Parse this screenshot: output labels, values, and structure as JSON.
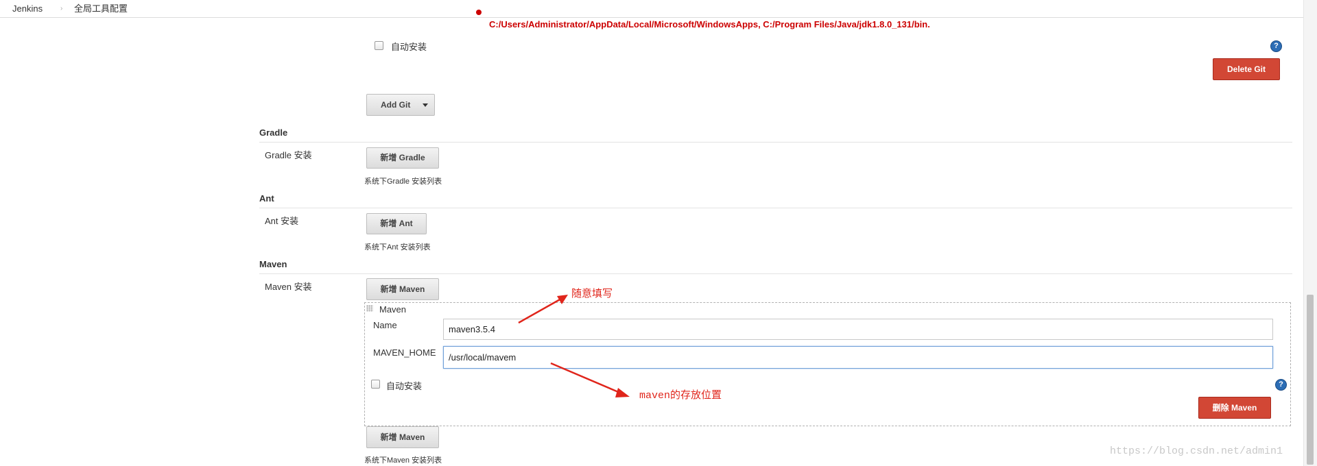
{
  "breadcrumb": {
    "items": [
      "Jenkins",
      "全局工具配置"
    ],
    "separator": "›"
  },
  "git": {
    "error_text": "C:/Users/Administrator/AppData/Local/Microsoft/WindowsApps, C:/Program Files/Java/jdk1.8.0_131/bin.",
    "auto_install_label": "自动安装",
    "delete_label": "Delete Git",
    "add_label": "Add Git"
  },
  "gradle": {
    "title": "Gradle",
    "install_label": "Gradle 安装",
    "add_label": "新增 Gradle",
    "hint": "系统下Gradle 安装列表"
  },
  "ant": {
    "title": "Ant",
    "install_label": "Ant 安装",
    "add_label": "新增 Ant",
    "hint": "系统下Ant 安装列表"
  },
  "maven": {
    "title": "Maven",
    "install_label": "Maven 安装",
    "add_label": "新增 Maven",
    "box_title": "Maven",
    "name_label": "Name",
    "name_value": "maven3.5.4",
    "home_label": "MAVEN_HOME",
    "home_value": "/usr/local/mavem",
    "auto_install_label": "自动安装",
    "delete_label": "删除 Maven",
    "add_label_bottom": "新增 Maven",
    "hint": "系统下Maven 安装列表"
  },
  "annotations": {
    "name_note": "随意填写",
    "home_note": "maven的存放位置"
  },
  "help_glyph": "?",
  "watermark": "https://blog.csdn.net/admin1",
  "colors": {
    "danger": "#d24735",
    "error_text": "#cc0000",
    "annotation": "#e0251b",
    "help": "#2c6db5"
  },
  "icons": [
    "help-icon",
    "dropdown-caret-icon",
    "drag-handle-icon",
    "error-bullet-icon",
    "annotation-arrow-icon"
  ]
}
